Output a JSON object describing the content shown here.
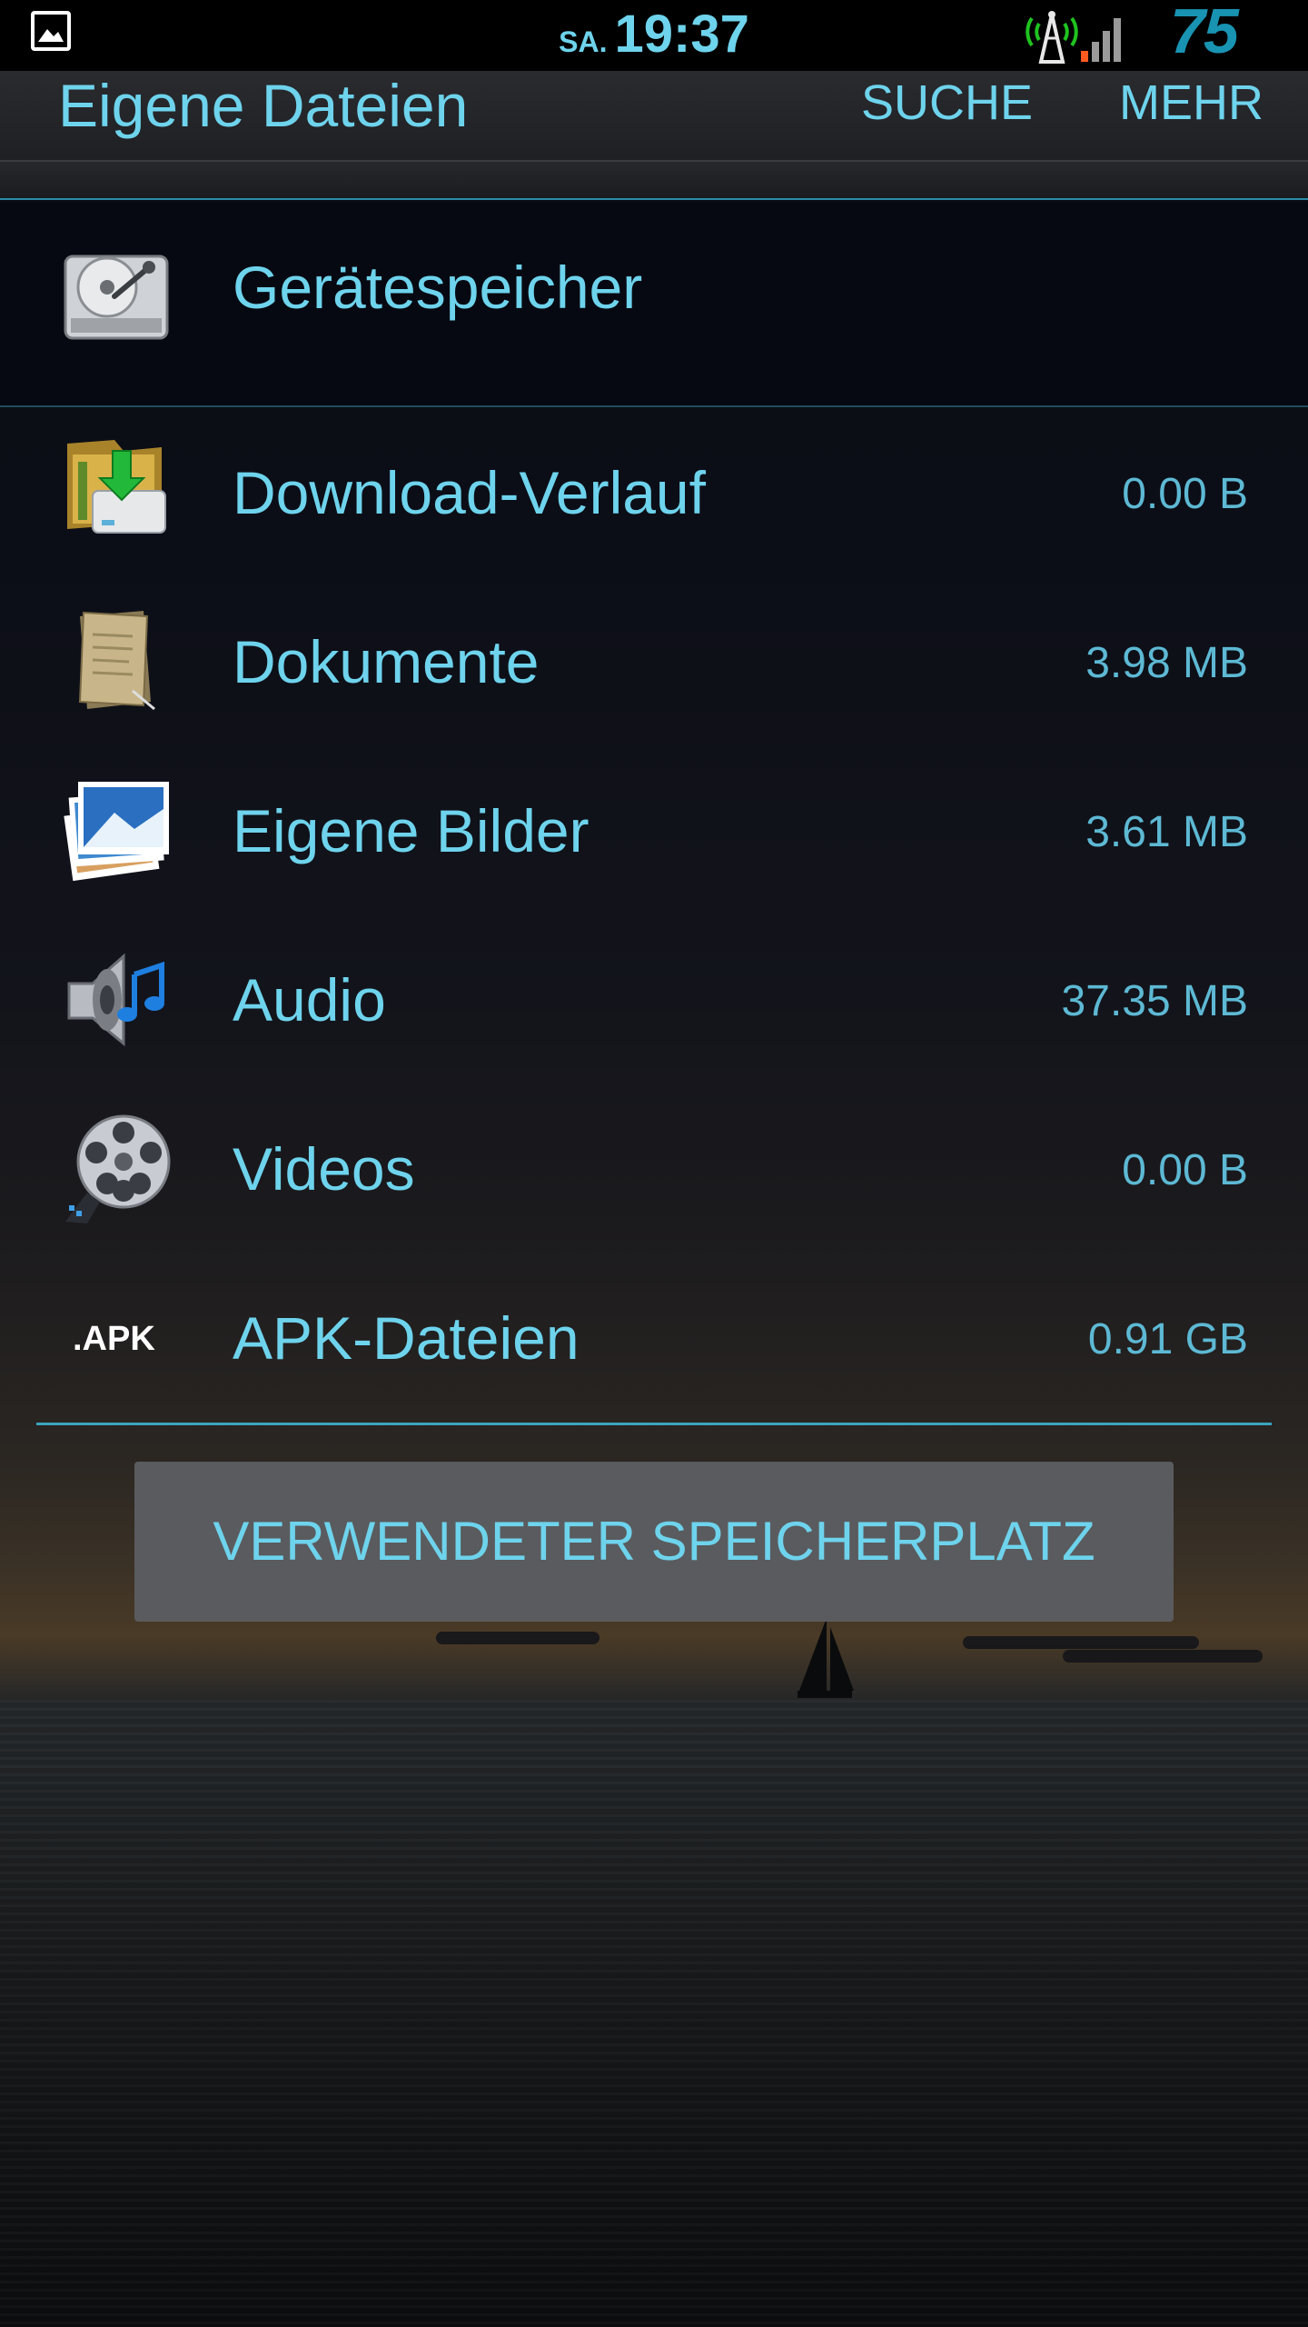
{
  "status_bar": {
    "day": "SA.",
    "time": "19:37",
    "battery": "75",
    "icons": [
      "picture-notification-icon",
      "signal-tower-icon",
      "signal-bars-icon"
    ]
  },
  "action_bar": {
    "title": "Eigene Dateien",
    "search_label": "SUCHE",
    "more_label": "MEHR"
  },
  "storage": {
    "label": "Gerätespeicher",
    "icon": "hard-drive-icon"
  },
  "categories": [
    {
      "label": "Download-Verlauf",
      "size": "0.00 B",
      "icon": "download-folder-icon"
    },
    {
      "label": "Dokumente",
      "size": "3.98 MB",
      "icon": "documents-icon"
    },
    {
      "label": "Eigene Bilder",
      "size": "3.61 MB",
      "icon": "pictures-icon"
    },
    {
      "label": "Audio",
      "size": "37.35 MB",
      "icon": "audio-speaker-icon"
    },
    {
      "label": "Videos",
      "size": "0.00 B",
      "icon": "film-reel-icon"
    },
    {
      "label": "APK-Dateien",
      "size": "0.91 GB",
      "icon": "apk-icon",
      "icon_text": ".APK"
    }
  ],
  "used_space_button": "VERWENDETER SPEICHERPLATZ",
  "colors": {
    "accent": "#6ed3ec",
    "size_text": "#5db9d4",
    "status_bar_bg": "#000000",
    "button_bg": "#5a5b5e"
  }
}
